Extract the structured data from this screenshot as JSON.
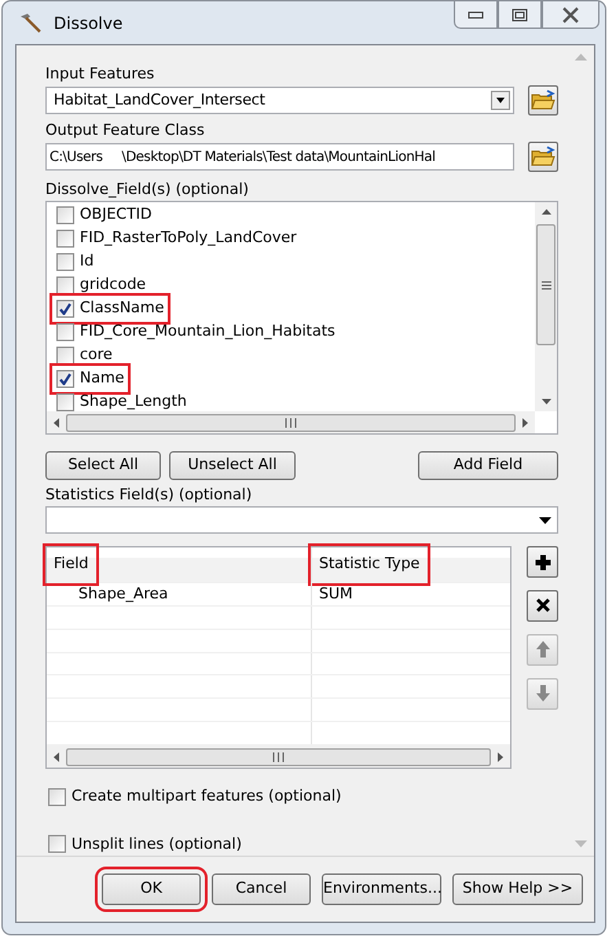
{
  "window": {
    "title": "Dissolve"
  },
  "input_features": {
    "label": "Input Features",
    "value": "Habitat_LandCover_Intersect"
  },
  "output_feature_class": {
    "label": "Output Feature Class",
    "value_parts": [
      "C:\\Users",
      "\\Desktop\\DT Materials\\Test data\\MountainLionHal"
    ]
  },
  "dissolve_fields": {
    "label": "Dissolve_Field(s) (optional)",
    "items": [
      {
        "label": "OBJECTID",
        "checked": false,
        "highlighted": false
      },
      {
        "label": "FID_RasterToPoly_LandCover",
        "checked": false,
        "highlighted": false
      },
      {
        "label": "Id",
        "checked": false,
        "highlighted": false
      },
      {
        "label": "gridcode",
        "checked": false,
        "highlighted": false
      },
      {
        "label": "ClassName",
        "checked": true,
        "highlighted": true
      },
      {
        "label": "FID_Core_Mountain_Lion_Habitats",
        "checked": false,
        "highlighted": false
      },
      {
        "label": "core",
        "checked": false,
        "highlighted": false
      },
      {
        "label": "Name",
        "checked": true,
        "highlighted": true
      },
      {
        "label": "Shape_Length",
        "checked": false,
        "highlighted": false
      }
    ],
    "buttons": [
      "Select All",
      "Unselect All",
      "Add Field"
    ]
  },
  "statistics_fields": {
    "label": "Statistics Field(s) (optional)",
    "columns": [
      {
        "label": "Field",
        "highlighted": true
      },
      {
        "label": "Statistic Type",
        "highlighted": true
      }
    ],
    "rows": [
      [
        "Shape_Area",
        "SUM"
      ]
    ]
  },
  "options": [
    {
      "label": "Create multipart features (optional)",
      "checked": false
    },
    {
      "label": "Unsplit lines (optional)",
      "checked": false
    }
  ],
  "footer_buttons": [
    {
      "label": "OK",
      "highlighted": true
    },
    {
      "label": "Cancel",
      "highlighted": false
    },
    {
      "label": "Environments...",
      "highlighted": false
    },
    {
      "label": "Show Help >>",
      "highlighted": false
    }
  ]
}
